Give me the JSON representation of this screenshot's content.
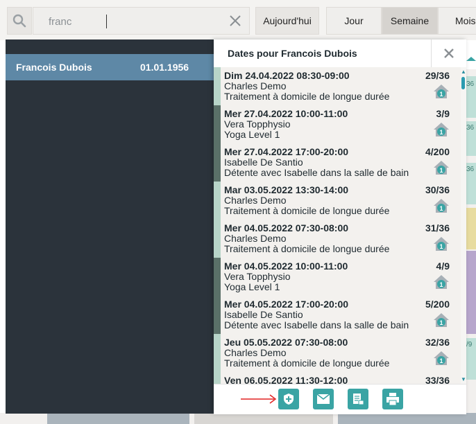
{
  "search": {
    "value": "franc"
  },
  "toolbar": {
    "today_label": "Aujourd'hui",
    "views": [
      {
        "label": "Jour",
        "active": false
      },
      {
        "label": "Semaine",
        "active": true
      },
      {
        "label": "Mois",
        "active": false
      }
    ]
  },
  "results": [
    {
      "name": "Francois Dubois",
      "dob": "01.01.1956"
    }
  ],
  "popover": {
    "title": "Dates pour Francois Dubois",
    "appointments": [
      {
        "datetime": "Dim 24.04.2022 08:30-09:00",
        "therapist": "Charles Demo",
        "service": "Traitement à domicile de longue durée",
        "count": "29/36",
        "badge": "1",
        "bar_color": "#b7d4c8"
      },
      {
        "datetime": "Mer 27.04.2022 10:00-11:00",
        "therapist": "Vera Topphysio",
        "service": "Yoga Level 1",
        "count": "3/9",
        "badge": "1",
        "bar_color": "#5a7068"
      },
      {
        "datetime": "Mer 27.04.2022 17:00-20:00",
        "therapist": "Isabelle De Santio",
        "service": "Détente avec Isabelle dans la salle de bain",
        "count": "4/200",
        "badge": "1",
        "bar_color": "#5a7068"
      },
      {
        "datetime": "Mar 03.05.2022 13:30-14:00",
        "therapist": "Charles Demo",
        "service": "Traitement à domicile de longue durée",
        "count": "30/36",
        "badge": "1",
        "bar_color": "#b7d4c8"
      },
      {
        "datetime": "Mer 04.05.2022 07:30-08:00",
        "therapist": "Charles Demo",
        "service": "Traitement à domicile de longue durée",
        "count": "31/36",
        "badge": "1",
        "bar_color": "#b7d4c8"
      },
      {
        "datetime": "Mer 04.05.2022 10:00-11:00",
        "therapist": "Vera Topphysio",
        "service": "Yoga Level 1",
        "count": "4/9",
        "badge": "1",
        "bar_color": "#5a7068"
      },
      {
        "datetime": "Mer 04.05.2022 17:00-20:00",
        "therapist": "Isabelle De Santio",
        "service": "Détente avec Isabelle dans la salle de bain",
        "count": "5/200",
        "badge": "1",
        "bar_color": "#5a7068"
      },
      {
        "datetime": "Jeu 05.05.2022 07:30-08:00",
        "therapist": "Charles Demo",
        "service": "Traitement à domicile de longue durée",
        "count": "32/36",
        "badge": "1",
        "bar_color": "#b7d4c8"
      },
      {
        "datetime": "Ven 06.05.2022 11:30-12:00",
        "therapist": "",
        "service": "",
        "count": "33/36",
        "badge": "",
        "bar_color": "#b7d4c8"
      }
    ],
    "footer_actions": [
      {
        "name": "shield-plus-button",
        "icon": "shield-plus-icon"
      },
      {
        "name": "email-button",
        "icon": "envelope-icon"
      },
      {
        "name": "export-document-button",
        "icon": "document-export-icon"
      },
      {
        "name": "print-button",
        "icon": "printer-icon"
      }
    ]
  },
  "background_calendar": {
    "visible_numbers": [
      "36",
      "36",
      "36",
      "36",
      "/9"
    ]
  },
  "colors": {
    "accent": "#3aa4a4",
    "selected_row": "#5e88a6",
    "dark_panel": "#2b333b",
    "annotation_arrow": "#e02020"
  }
}
